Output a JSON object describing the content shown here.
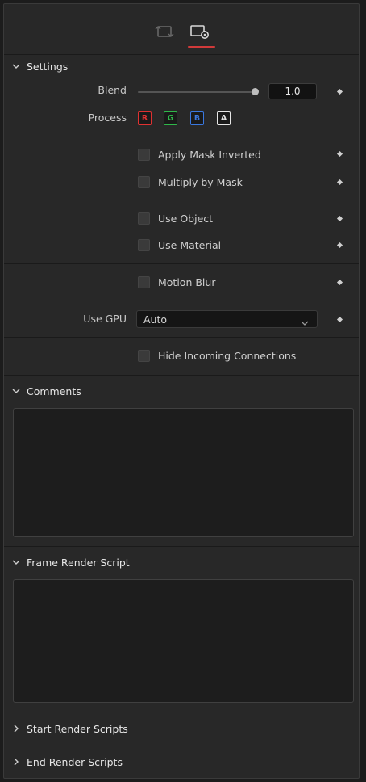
{
  "tabs": [
    {
      "name": "swap-views-tab",
      "icon": "swap-views-icon"
    },
    {
      "name": "settings-tab",
      "icon": "settings-gear-icon",
      "active": true
    }
  ],
  "settings": {
    "title": "Settings",
    "blend": {
      "label": "Blend",
      "value": "1.0",
      "fraction": 1.0
    },
    "process": {
      "label": "Process",
      "channels": [
        {
          "id": "R",
          "color": "#e03131"
        },
        {
          "id": "G",
          "color": "#2fb84a"
        },
        {
          "id": "B",
          "color": "#3a78e0"
        },
        {
          "id": "A",
          "color": "#e6e6e6"
        }
      ]
    },
    "checkboxes": {
      "apply_mask_inverted": "Apply Mask Inverted",
      "multiply_by_mask": "Multiply by Mask",
      "use_object": "Use Object",
      "use_material": "Use Material",
      "motion_blur": "Motion Blur",
      "hide_incoming": "Hide Incoming Connections"
    },
    "use_gpu": {
      "label": "Use GPU",
      "value": "Auto"
    }
  },
  "comments": {
    "title": "Comments",
    "value": ""
  },
  "frame_render_script": {
    "title": "Frame Render Script",
    "value": ""
  },
  "start_render_scripts": {
    "title": "Start Render Scripts"
  },
  "end_render_scripts": {
    "title": "End Render Scripts"
  },
  "colors": {
    "accent_tab": "#d13a3a",
    "panel_bg": "#282828",
    "text": "#d2d2d2"
  }
}
